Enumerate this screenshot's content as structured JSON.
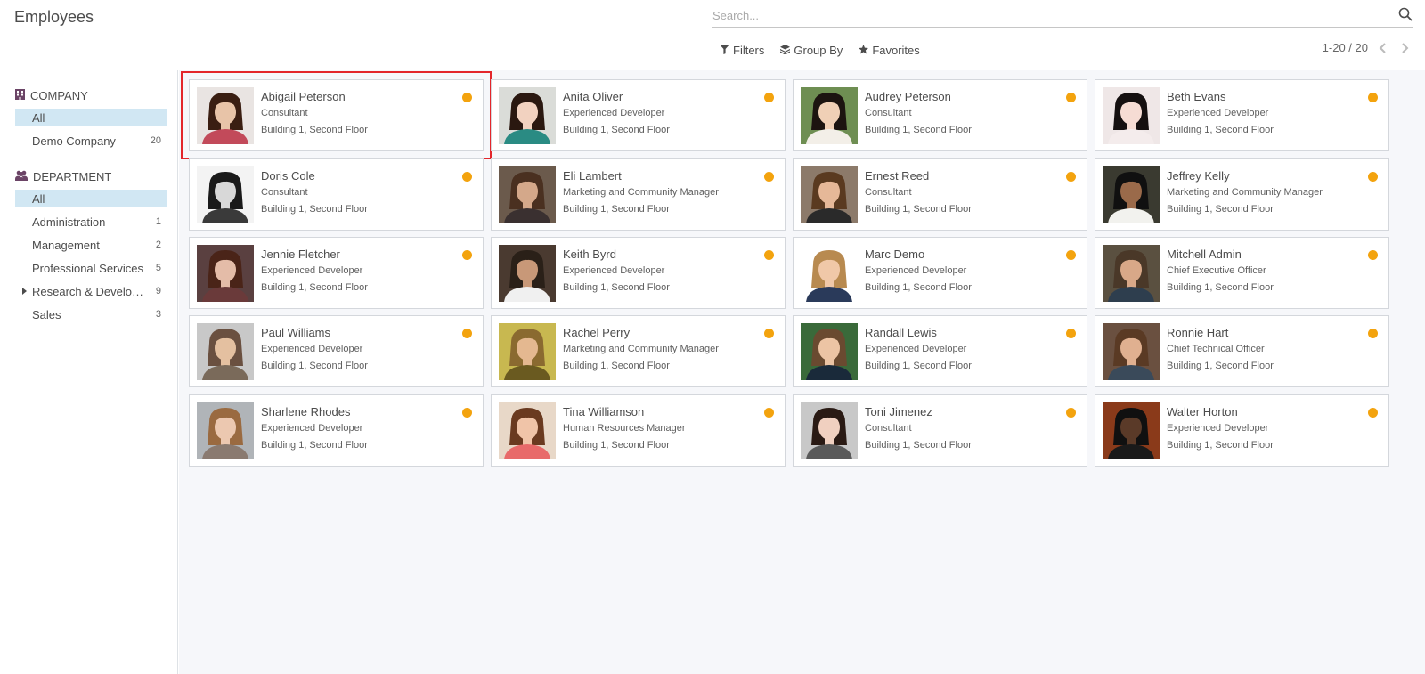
{
  "breadcrumb": "Employees",
  "search": {
    "placeholder": "Search..."
  },
  "filters": {
    "filters_label": "Filters",
    "group_by_label": "Group By",
    "favorites_label": "Favorites"
  },
  "pager": {
    "value": "1-20 / 20"
  },
  "sidebar": {
    "company": {
      "header": "COMPANY",
      "items": [
        {
          "label": "All",
          "count": "",
          "active": true
        },
        {
          "label": "Demo Company",
          "count": "20",
          "active": false
        }
      ]
    },
    "department": {
      "header": "DEPARTMENT",
      "items": [
        {
          "label": "All",
          "count": "",
          "active": true
        },
        {
          "label": "Administration",
          "count": "1",
          "active": false
        },
        {
          "label": "Management",
          "count": "2",
          "active": false
        },
        {
          "label": "Professional Services",
          "count": "5",
          "active": false
        },
        {
          "label": "Research & Development",
          "count": "9",
          "active": false,
          "expandable": true
        },
        {
          "label": "Sales",
          "count": "3",
          "active": false
        }
      ]
    }
  },
  "colors": {
    "status_dot": "#f3a30e",
    "sidebar_active": "#d1e7f3",
    "selection_outline": "#e3262b",
    "icon_purple": "#6b4466"
  },
  "employees": [
    {
      "name": "Abigail Peterson",
      "job": "Consultant",
      "location": "Building 1, Second Floor",
      "skin": "#e8c4a8",
      "hair": "#3a1e12",
      "bg": "#e9e4e2",
      "shirt": "#c24a5a"
    },
    {
      "name": "Anita Oliver",
      "job": "Experienced Developer",
      "location": "Building 1, Second Floor",
      "skin": "#f2d2c0",
      "hair": "#2a1810",
      "bg": "#dadcd8",
      "shirt": "#2a8b83"
    },
    {
      "name": "Audrey Peterson",
      "job": "Consultant",
      "location": "Building 1, Second Floor",
      "skin": "#f0d0b6",
      "hair": "#1c1410",
      "bg": "#6e8e52",
      "shirt": "#f3efe8"
    },
    {
      "name": "Beth Evans",
      "job": "Experienced Developer",
      "location": "Building 1, Second Floor",
      "skin": "#f6dcd4",
      "hair": "#151010",
      "bg": "#efe7e7",
      "shirt": "#f4ecec"
    },
    {
      "name": "Doris Cole",
      "job": "Consultant",
      "location": "Building 1, Second Floor",
      "skin": "#d8d8d8",
      "hair": "#1a1a1a",
      "bg": "#f3f3f3",
      "shirt": "#3a3a3a"
    },
    {
      "name": "Eli Lambert",
      "job": "Marketing and Community Manager",
      "location": "Building 1, Second Floor",
      "skin": "#d4a88a",
      "hair": "#4a3020",
      "bg": "#6b5a4c",
      "shirt": "#3a3030"
    },
    {
      "name": "Ernest Reed",
      "job": "Consultant",
      "location": "Building 1, Second Floor",
      "skin": "#e6b898",
      "hair": "#5a3a20",
      "bg": "#8c7a6a",
      "shirt": "#2a2a2a"
    },
    {
      "name": "Jeffrey Kelly",
      "job": "Marketing and Community Manager",
      "location": "Building 1, Second Floor",
      "skin": "#9a6a4a",
      "hair": "#101010",
      "bg": "#3a3a30",
      "shirt": "#f2f2ee"
    },
    {
      "name": "Jennie Fletcher",
      "job": "Experienced Developer",
      "location": "Building 1, Second Floor",
      "skin": "#e4bca8",
      "hair": "#4a2418",
      "bg": "#5a4040",
      "shirt": "#6a3a3a"
    },
    {
      "name": "Keith Byrd",
      "job": "Experienced Developer",
      "location": "Building 1, Second Floor",
      "skin": "#c89878",
      "hair": "#2a2018",
      "bg": "#4a3a30",
      "shirt": "#f0f0f0"
    },
    {
      "name": "Marc Demo",
      "job": "Experienced Developer",
      "location": "Building 1, Second Floor",
      "skin": "#f0c8a8",
      "hair": "#b88a50",
      "bg": "#ffffff",
      "shirt": "#2a3a5a"
    },
    {
      "name": "Mitchell Admin",
      "job": "Chief Executive Officer",
      "location": "Building 1, Second Floor",
      "skin": "#d8a888",
      "hair": "#4a3828",
      "bg": "#5a5040",
      "shirt": "#2e3e4e"
    },
    {
      "name": "Paul Williams",
      "job": "Experienced Developer",
      "location": "Building 1, Second Floor",
      "skin": "#e4c0a0",
      "hair": "#6a5040",
      "bg": "#c8c8c8",
      "shirt": "#7a6a5a"
    },
    {
      "name": "Rachel Perry",
      "job": "Marketing and Community Manager",
      "location": "Building 1, Second Floor",
      "skin": "#e4b890",
      "hair": "#8a6a30",
      "bg": "#c8b850",
      "shirt": "#6a5a20"
    },
    {
      "name": "Randall Lewis",
      "job": "Experienced Developer",
      "location": "Building 1, Second Floor",
      "skin": "#ecc4a4",
      "hair": "#6a4a30",
      "bg": "#3a6a3a",
      "shirt": "#1a2a3a"
    },
    {
      "name": "Ronnie Hart",
      "job": "Chief Technical Officer",
      "location": "Building 1, Second Floor",
      "skin": "#e0b090",
      "hair": "#5a3a24",
      "bg": "#6a5040",
      "shirt": "#3a4a5a"
    },
    {
      "name": "Sharlene Rhodes",
      "job": "Experienced Developer",
      "location": "Building 1, Second Floor",
      "skin": "#ecc8b0",
      "hair": "#9a6a40",
      "bg": "#b0b4b8",
      "shirt": "#8a7a70"
    },
    {
      "name": "Tina Williamson",
      "job": "Human Resources Manager",
      "location": "Building 1, Second Floor",
      "skin": "#f0c4a8",
      "hair": "#6a3a20",
      "bg": "#e8d8c8",
      "shirt": "#e86a6a"
    },
    {
      "name": "Toni Jimenez",
      "job": "Consultant",
      "location": "Building 1, Second Floor",
      "skin": "#f0d0c0",
      "hair": "#2a1a14",
      "bg": "#c8c8c8",
      "shirt": "#5a5a5a"
    },
    {
      "name": "Walter Horton",
      "job": "Experienced Developer",
      "location": "Building 1, Second Floor",
      "skin": "#5a3a28",
      "hair": "#101010",
      "bg": "#8a3a1a",
      "shirt": "#1a1a1a"
    }
  ]
}
